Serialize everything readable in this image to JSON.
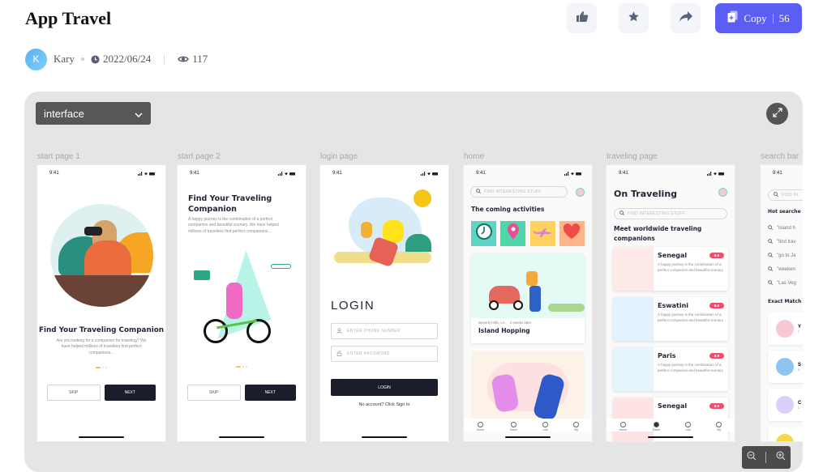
{
  "header": {
    "title": "App Travel",
    "author": {
      "initial": "K",
      "name": "Kary"
    },
    "date": "2022/06/24",
    "views": "117",
    "actions": {
      "like_icon": "thumbs-up-icon",
      "favorite_icon": "star-icon",
      "share_icon": "share-icon"
    },
    "copy": {
      "label": "Copy",
      "count": "56"
    }
  },
  "canvas": {
    "dropdown": {
      "selected": "interface"
    },
    "pages": [
      {
        "label": "start page 1"
      },
      {
        "label": "start page 2"
      },
      {
        "label": "login page"
      },
      {
        "label": "home"
      },
      {
        "label": "traveling page"
      },
      {
        "label": "search bar"
      }
    ]
  },
  "status_time": "9:41",
  "start1": {
    "heading": "Find Your Traveling Companion",
    "body": "Are you looking for a companion for traveling? We have helped millions of travellers find perfect companions...",
    "skip": "SKIP",
    "next": "NEXT"
  },
  "start2": {
    "heading": "Find Your Traveling Companion",
    "body": "A happy journey is the combination of a perfect companion and beautiful scenary. We have helped millions of travellers find perfect companions...",
    "skip": "SKIP",
    "next": "NEXT"
  },
  "login": {
    "heading": "LOGIN",
    "phone_placeholder": "ENTER PHONE NUNBER",
    "password_placeholder": "ENTER PASSWORD",
    "button": "LOGIN",
    "signup": "No account? Click Sign In"
  },
  "home": {
    "search_placeholder": "FIND INTERESTING STUFF",
    "section": "The coming activities",
    "categories": [
      {
        "icon": "clock-icon",
        "color": "#5fd3c4"
      },
      {
        "icon": "location-pin-icon",
        "color": "#4fd6a8"
      },
      {
        "icon": "airplane-icon",
        "color": "#ffd25e"
      },
      {
        "icon": "heart-icon",
        "color": "#ffb48a"
      }
    ],
    "activity": {
      "location": "Beverly Hills, LA",
      "when": "2 weeks later",
      "title": "Island Hopping"
    },
    "tabs": [
      "Home",
      "Travel",
      "Like",
      "My"
    ]
  },
  "traveling": {
    "heading": "On Traveling",
    "search_placeholder": "FIND INTERESTING STUFF",
    "section": "Meet worldwide traveling companions",
    "cards": [
      {
        "name": "Senegal",
        "score": "8.9",
        "desc": "A happy journey is the combination of a perfect companion and beautiful scenary",
        "color": "#fde9e6"
      },
      {
        "name": "Eswatini",
        "score": "8.9",
        "desc": "A happy journey is the combination of a perfect companion and beautiful scenary",
        "color": "#e3f2fd"
      },
      {
        "name": "Paris",
        "score": "8.9",
        "desc": "A happy journey is the combination of a perfect companion and beautiful scenary",
        "color": "#e6f4fb"
      },
      {
        "name": "Senegal",
        "score": "8.9",
        "desc": "",
        "color": "#fde3e3"
      }
    ],
    "tabs": [
      "Home",
      "Travel",
      "Like",
      "My"
    ]
  },
  "searchbar": {
    "search_placeholder": "FIND IN",
    "hot_title": "Hot searche",
    "hot": [
      "\"island h",
      "\"find trav",
      "\"go to Ja",
      "\"weeken",
      "\"Las Veg"
    ],
    "exact_title": "Exact Match",
    "matches": [
      {
        "initial": "Y",
        "sub": "I'",
        "color": "#f7c7d3"
      },
      {
        "initial": "S",
        "sub": "D",
        "color": "#8ec4f0"
      },
      {
        "initial": "C",
        "sub": "L",
        "color": "#dcd0fb"
      },
      {
        "initial": "",
        "sub": "",
        "color": "#f7d84a"
      }
    ]
  }
}
